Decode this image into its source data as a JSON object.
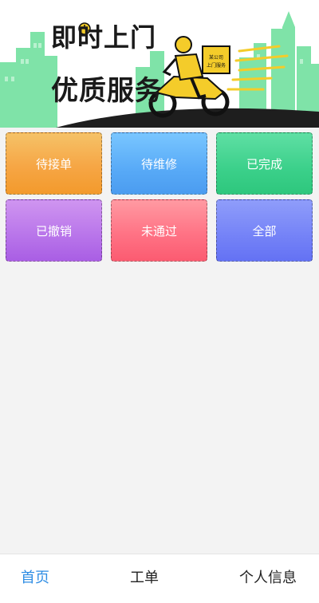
{
  "banner": {
    "slogan_line1": "即时上门",
    "slogan_line2": "优质服务",
    "box_text_1": "某公司",
    "box_text_2": "上门服务"
  },
  "orders": {
    "items": [
      {
        "label": "待接单"
      },
      {
        "label": "待维修"
      },
      {
        "label": "已完成"
      },
      {
        "label": "已撤销"
      },
      {
        "label": "未通过"
      },
      {
        "label": "全部"
      }
    ]
  },
  "tabbar": {
    "items": [
      {
        "label": "首页",
        "active": true
      },
      {
        "label": "工单"
      },
      {
        "label": "个人信息"
      }
    ]
  },
  "colors": {
    "accent": "#2f8de4",
    "skyline": "#7fe3a8",
    "road": "#1e1e1e",
    "scooter": "#f4cc2a"
  }
}
